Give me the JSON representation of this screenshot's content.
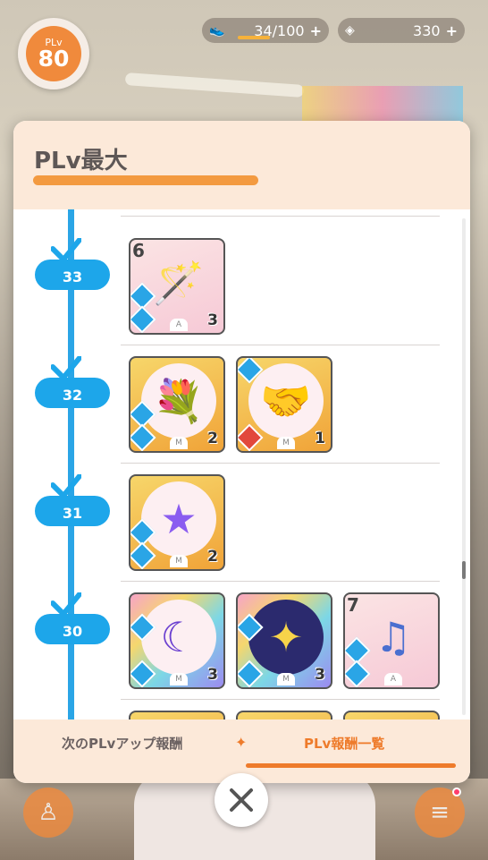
{
  "hud": {
    "plv_label": "PLv",
    "plv_value": "80",
    "stamina": "34/100",
    "gems": "330",
    "stamina_icon": "shoe-icon",
    "gem_icon": "diamond-icon"
  },
  "panel": {
    "title": "PLv最大"
  },
  "rows": [
    {
      "level": "33",
      "rewards": [
        {
          "corner_number": "6",
          "type": "A",
          "count": "3",
          "art": "glowstick"
        }
      ]
    },
    {
      "level": "32",
      "rewards": [
        {
          "type": "M",
          "count": "2",
          "art": "bouquet"
        },
        {
          "type": "M",
          "count": "1",
          "art": "hands"
        }
      ]
    },
    {
      "level": "31",
      "rewards": [
        {
          "type": "M",
          "count": "2",
          "art": "star"
        }
      ]
    },
    {
      "level": "30",
      "rewards": [
        {
          "type": "M",
          "count": "3",
          "art": "crescent"
        },
        {
          "type": "M",
          "count": "3",
          "art": "stars"
        },
        {
          "corner_number": "7",
          "type": "A",
          "count": "",
          "art": "dancers"
        }
      ]
    }
  ],
  "tabs": {
    "next": "次のPLvアップ報酬",
    "list": "PLv報酬一覧",
    "separator": "✦"
  },
  "colors": {
    "accent_orange": "#ee7b2b",
    "timeline_blue": "#1da6ea",
    "panel_header": "#fce9d9"
  }
}
